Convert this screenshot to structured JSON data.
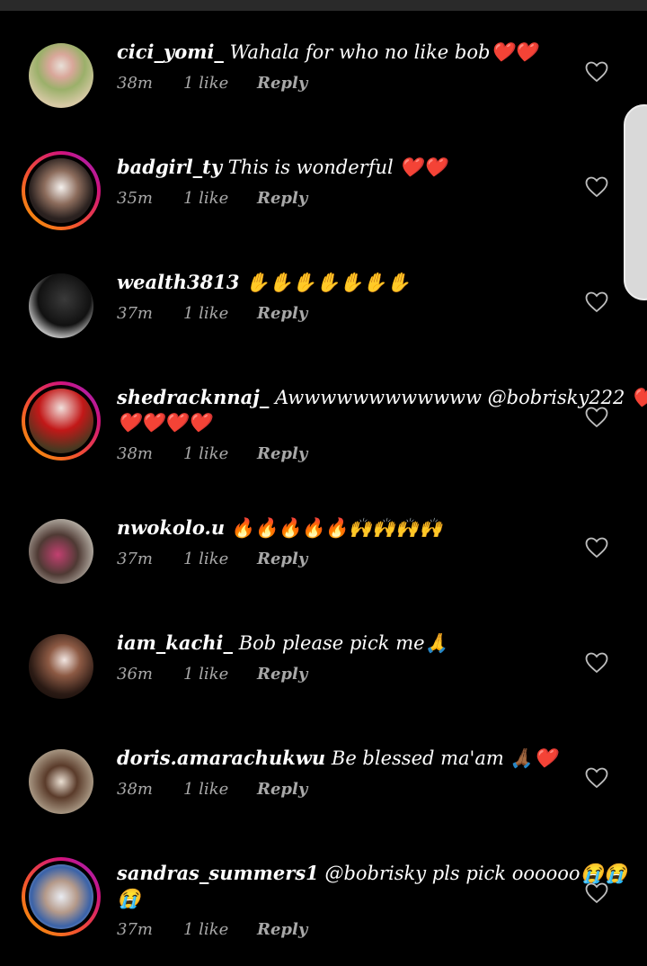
{
  "comments": [
    {
      "username": "cici_yomi_",
      "text": "Wahala for who no like bob❤️❤️",
      "time": "38m",
      "likes": "1 like",
      "reply": "Reply",
      "story_ring": false
    },
    {
      "username": "badgirl_ty",
      "text": "This is wonderful ❤️❤️",
      "time": "35m",
      "likes": "1 like",
      "reply": "Reply",
      "story_ring": true
    },
    {
      "username": "wealth3813",
      "text": "✋✋✋✋✋✋✋",
      "time": "37m",
      "likes": "1 like",
      "reply": "Reply",
      "story_ring": false
    },
    {
      "username": "shedracknnaj_",
      "text": "Awwwwwwwwwwww @bobrisky222 ❤️",
      "text_line2": "❤️❤️❤️❤️",
      "time": "38m",
      "likes": "1 like",
      "reply": "Reply",
      "story_ring": true
    },
    {
      "username": "nwokolo.u",
      "text": "🔥🔥🔥🔥🔥🙌🙌🙌🙌",
      "time": "37m",
      "likes": "1 like",
      "reply": "Reply",
      "story_ring": false
    },
    {
      "username": "iam_kachi_",
      "text": "Bob please pick me🙏",
      "time": "36m",
      "likes": "1 like",
      "reply": "Reply",
      "story_ring": false
    },
    {
      "username": "doris.amarachukwu",
      "text": "Be blessed ma'am 🙏🏾❤️",
      "time": "38m",
      "likes": "1 like",
      "reply": "Reply",
      "story_ring": false
    },
    {
      "username": "sandras_summers1",
      "text": "@bobrisky pls pick oooooo😭😭",
      "text_line2": "😭",
      "time": "37m",
      "likes": "1 like",
      "reply": "Reply",
      "story_ring": true
    }
  ],
  "icons": {
    "like": "heart-outline-icon"
  },
  "colors": {
    "background": "#000000",
    "meta_text": "#a8a8a8",
    "scroll_handle": "#d9d9d9"
  }
}
